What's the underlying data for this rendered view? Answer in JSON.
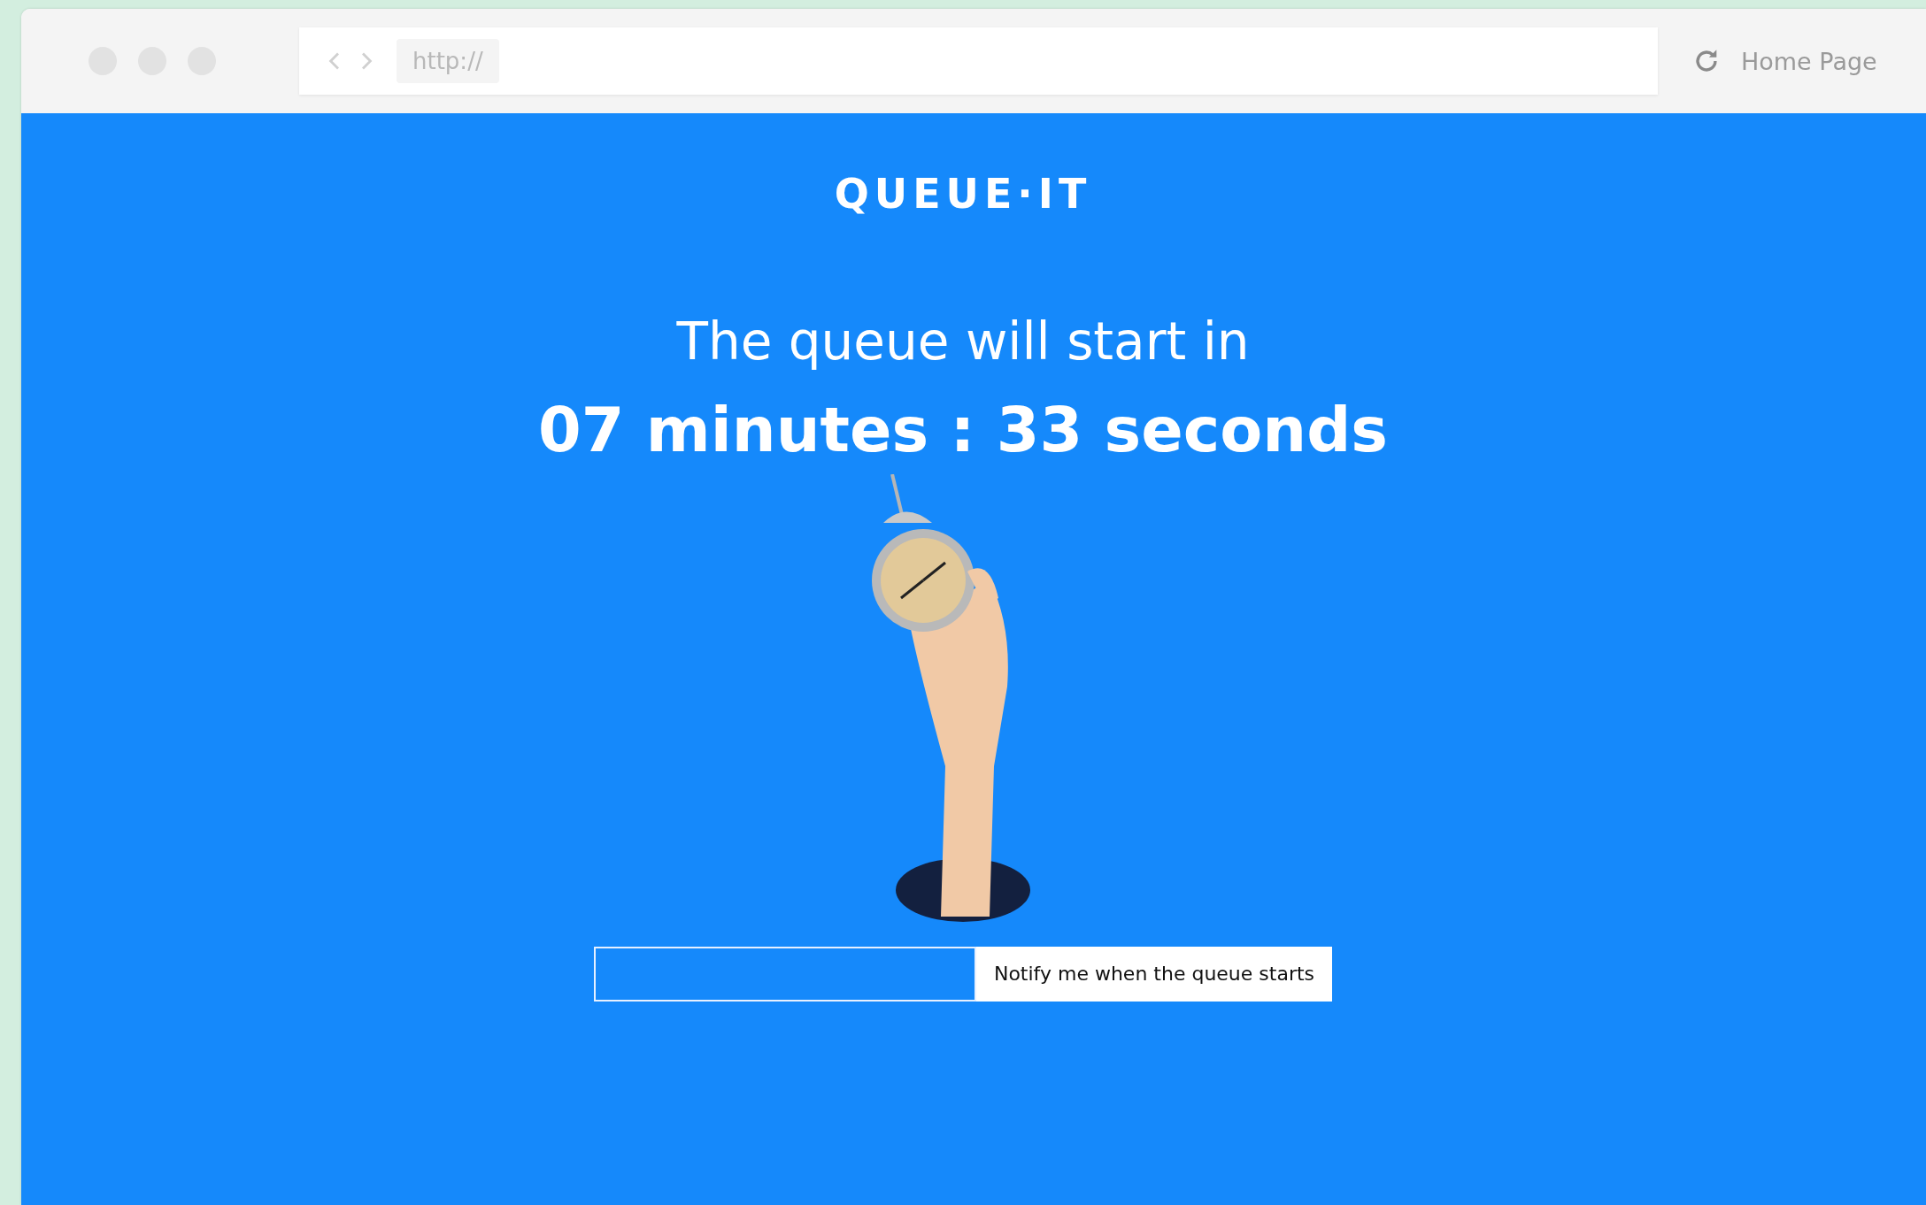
{
  "browser": {
    "url": "http://",
    "home_link": "Home Page"
  },
  "page": {
    "logo": "QUEUE·IT",
    "heading": "The queue will start in",
    "countdown": "07 minutes : 33 seconds",
    "notify_button": "Notify me when the queue starts"
  }
}
